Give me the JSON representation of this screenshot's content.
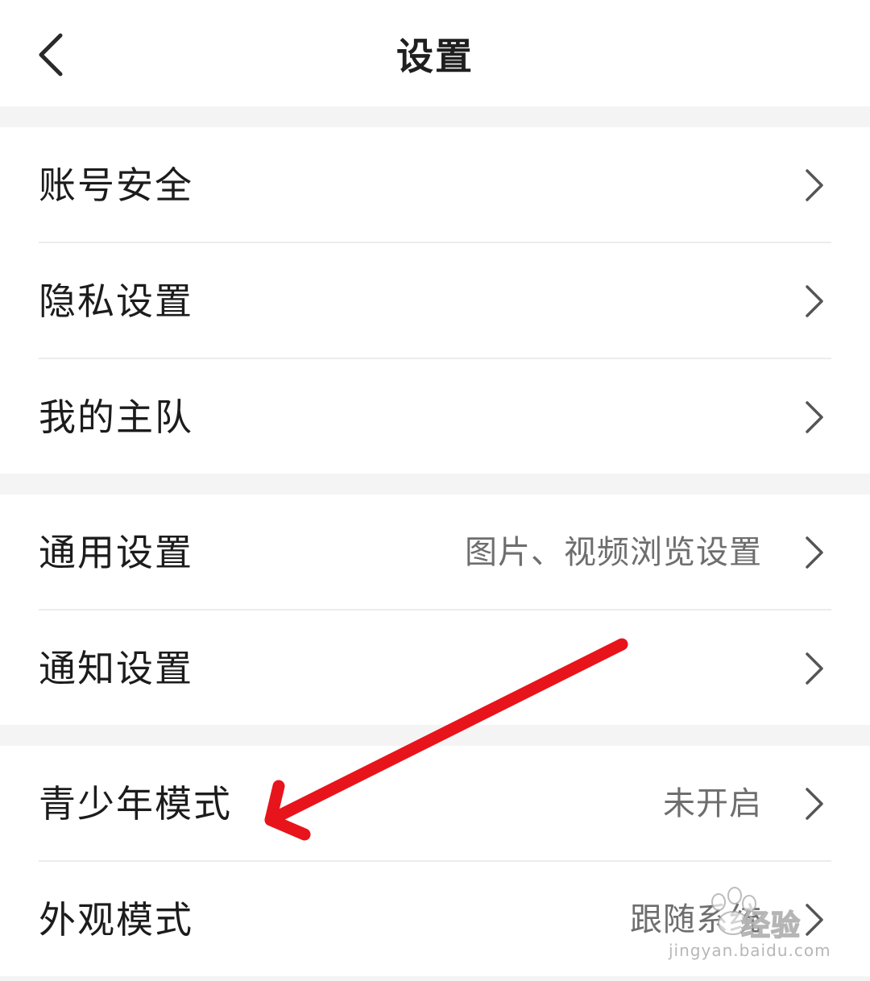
{
  "header": {
    "title": "设置",
    "back_icon": "chevron-left-icon"
  },
  "groups": [
    {
      "items": [
        {
          "label": "账号安全",
          "value": ""
        },
        {
          "label": "隐私设置",
          "value": ""
        },
        {
          "label": "我的主队",
          "value": ""
        }
      ]
    },
    {
      "items": [
        {
          "label": "通用设置",
          "value": "图片、视频浏览设置"
        },
        {
          "label": "通知设置",
          "value": ""
        }
      ]
    },
    {
      "items": [
        {
          "label": "青少年模式",
          "value": "未开启"
        },
        {
          "label": "外观模式",
          "value": "跟随系统"
        }
      ]
    }
  ],
  "annotation": {
    "arrow_color": "#e8141b",
    "points_to": "青少年模式"
  },
  "watermark": {
    "main": "经验",
    "sub": "jingyan.baidu.com"
  },
  "colors": {
    "background": "#f4f4f5",
    "card": "#ffffff",
    "text_primary": "#1c1c1c",
    "text_secondary": "#6e6e6e",
    "chevron": "#555555"
  }
}
